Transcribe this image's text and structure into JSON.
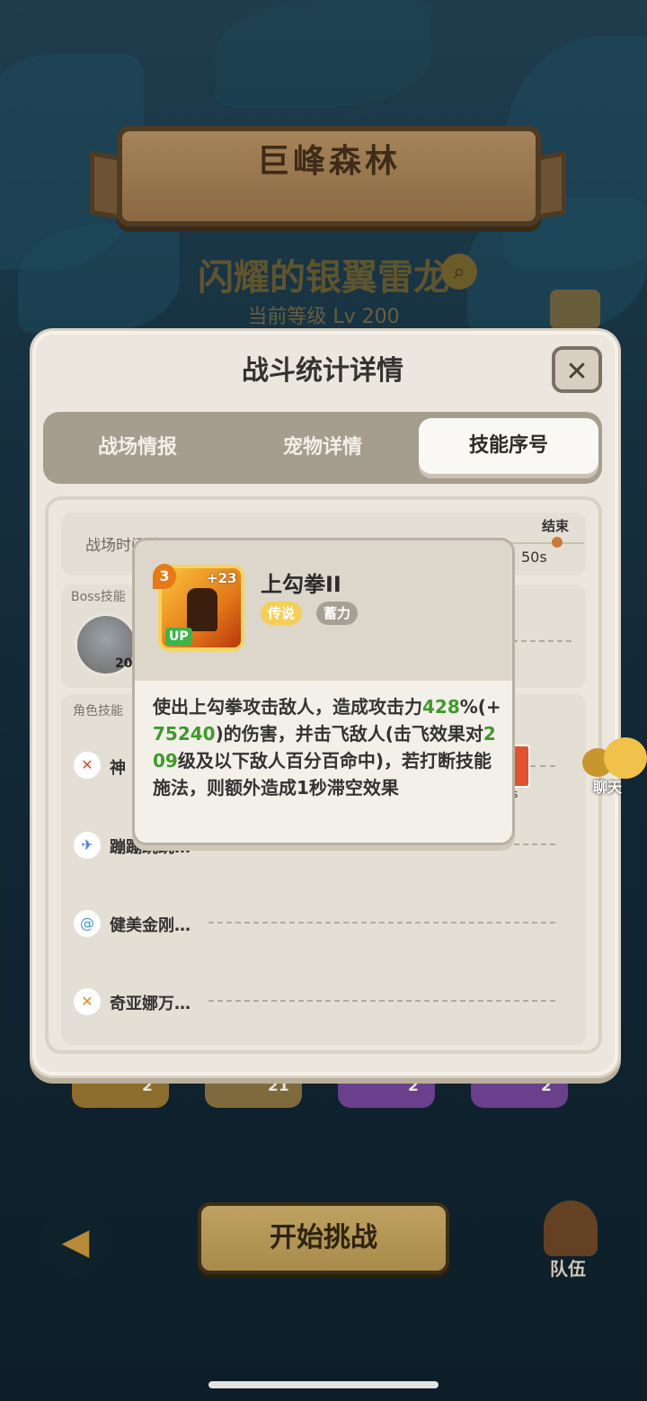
{
  "header": {
    "map_title": "巨峰森林",
    "boss_name": "闪耀的银翼雷龙",
    "level_text": "当前等级 Lv 200"
  },
  "panel": {
    "title": "战斗统计详情",
    "close_label": "✕",
    "tabs": [
      {
        "label": "战场情报",
        "active": false
      },
      {
        "label": "宠物详情",
        "active": false
      },
      {
        "label": "技能序号",
        "active": true
      }
    ]
  },
  "timeline": {
    "label": "战场时间轴",
    "end_label": "结束",
    "time_marker": "50s"
  },
  "boss_skills": {
    "label": "Boss技能",
    "boss_level": "20"
  },
  "role_skills": {
    "label": "角色技能",
    "rows": [
      {
        "name": "神",
        "icon": "sword-crossed-icon"
      },
      {
        "name": "蹦蹦跳跳…",
        "icon": "wing-icon"
      },
      {
        "name": "健美金刚…",
        "icon": "swirl-icon"
      },
      {
        "name": "奇亚娜万…",
        "icon": "blade-icon"
      }
    ],
    "side_time": "s"
  },
  "tooltip": {
    "skill_name": "上勾拳II",
    "skill_level": "3",
    "skill_plus": "+23",
    "up_badge": "UP",
    "tags": [
      "传说",
      "蓄力"
    ],
    "desc_parts": [
      {
        "text": "使出上勾拳攻击敌人，造成攻击力",
        "highlight": false
      },
      {
        "text": "428",
        "highlight": true
      },
      {
        "text": "%(+",
        "highlight": false
      },
      {
        "text": "75240",
        "highlight": true
      },
      {
        "text": ")的伤害，并击飞敌人(击飞效果对",
        "highlight": false
      },
      {
        "text": "209",
        "highlight": true
      },
      {
        "text": "级及以下敌人百分百命中)，若打断技能施法，则额外造成1秒滞空效果",
        "highlight": false
      }
    ]
  },
  "bottom": {
    "slots": [
      "2",
      "21",
      "2",
      "2"
    ],
    "start_button": "开始挑战",
    "back_icon": "back-arrow-icon",
    "team_label": "队伍",
    "chat_label": "聊天"
  },
  "colors": {
    "highlight_green": "#3f9a2a",
    "legend_tag": "#f5cf55",
    "accent_brown": "#a88a4b"
  }
}
